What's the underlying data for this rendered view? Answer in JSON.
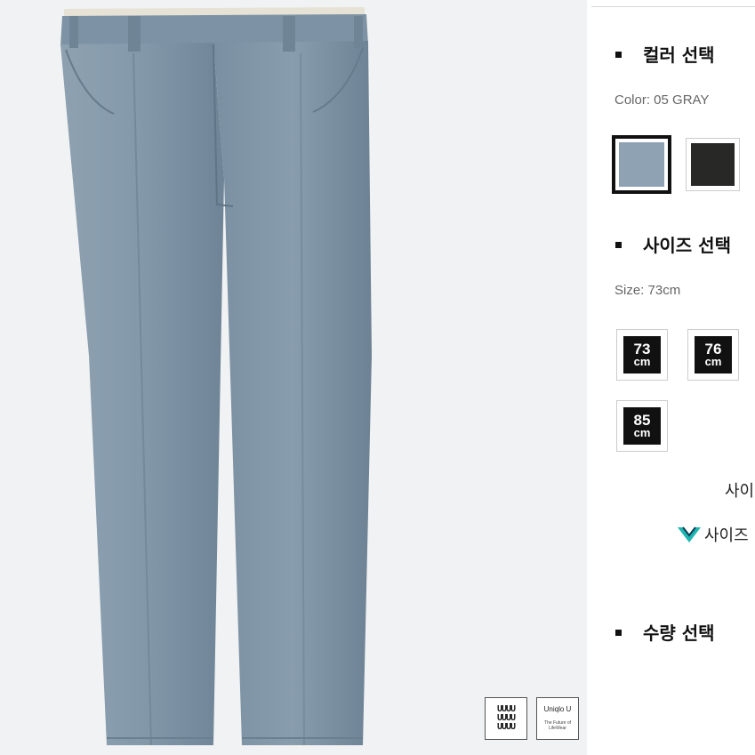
{
  "product": {
    "badges": {
      "grid_text": "UUUU\nUUUU\nUUUU",
      "brand": "Uniqlo U",
      "tagline": "The Future of LifeWear"
    }
  },
  "color": {
    "section_title": "컬러 선택",
    "selected_text": "Color: 05 GRAY",
    "swatches": [
      {
        "name": "gray",
        "hex": "#8ea2b4",
        "selected": true
      },
      {
        "name": "black",
        "hex": "#282826",
        "selected": false
      }
    ]
  },
  "size": {
    "section_title": "사이즈 선택",
    "selected_text": "Size: 73cm",
    "unit": "cm",
    "options": [
      "73",
      "76",
      "85"
    ],
    "guide_text": "사이",
    "link_text": "사이즈"
  },
  "quantity": {
    "section_title": "수량 선택"
  },
  "colors": {
    "accent_teal": "#1fb5b0",
    "pants_gray": "#7f95a6"
  }
}
